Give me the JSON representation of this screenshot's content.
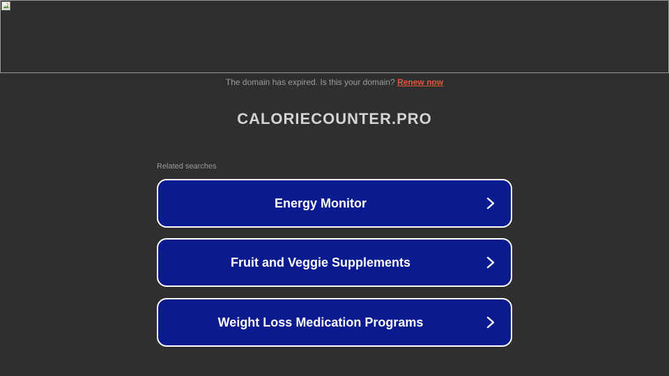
{
  "banner": {
    "icon": "broken-image-icon"
  },
  "notice": {
    "text": "The domain has expired. Is this your domain?",
    "renew_label": "Renew now"
  },
  "domain": {
    "title": "CALORIECOUNTER.PRO"
  },
  "related": {
    "label": "Related searches",
    "items": [
      {
        "label": "Energy Monitor"
      },
      {
        "label": "Fruit and Veggie Supplements"
      },
      {
        "label": "Weight Loss Medication Programs"
      }
    ]
  },
  "colors": {
    "background": "#2f2f2f",
    "button_bg": "#0a1a8f",
    "link": "#e0573a"
  }
}
